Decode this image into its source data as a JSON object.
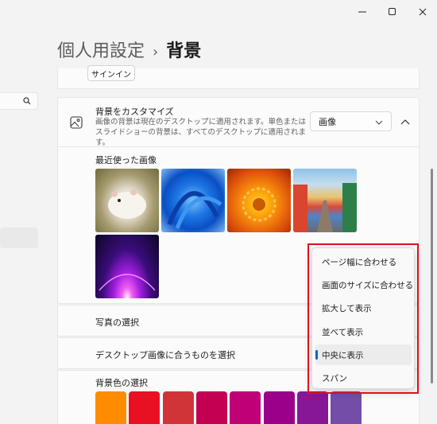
{
  "window": {
    "buttons": [
      {
        "name": "minimize",
        "glyph": "—"
      },
      {
        "name": "maximize",
        "glyph": "☐"
      },
      {
        "name": "close",
        "glyph": "✕"
      }
    ]
  },
  "breadcrumb": {
    "parent": "個人用設定",
    "separator": "›",
    "current": "背景"
  },
  "signin": {
    "label": "サインイン"
  },
  "background": {
    "title": "背景をカスタマイズ",
    "description": "画像の背景は現在のデスクトップに適用されます。単色またはスライドショーの背景は、すべてのデスクトップに適用されます。",
    "dropdown_value": "画像",
    "recent_label": "最近使った画像"
  },
  "rows": {
    "photo_select": "写真の選択",
    "fit_select": "デスクトップ画像に合うものを選択",
    "color_select": "背景色の選択"
  },
  "fit_menu": {
    "items": [
      "ページ幅に合わせる",
      "画面のサイズに合わせる",
      "拡大して表示",
      "並べて表示",
      "中央に表示",
      "スパン"
    ],
    "selected_index": 4
  },
  "colors": [
    "#ff8c00",
    "#e81123",
    "#d13438",
    "#c30052",
    "#bf0077",
    "#9a0089",
    "#881798",
    "#744da9"
  ],
  "accent": "#0067c0"
}
